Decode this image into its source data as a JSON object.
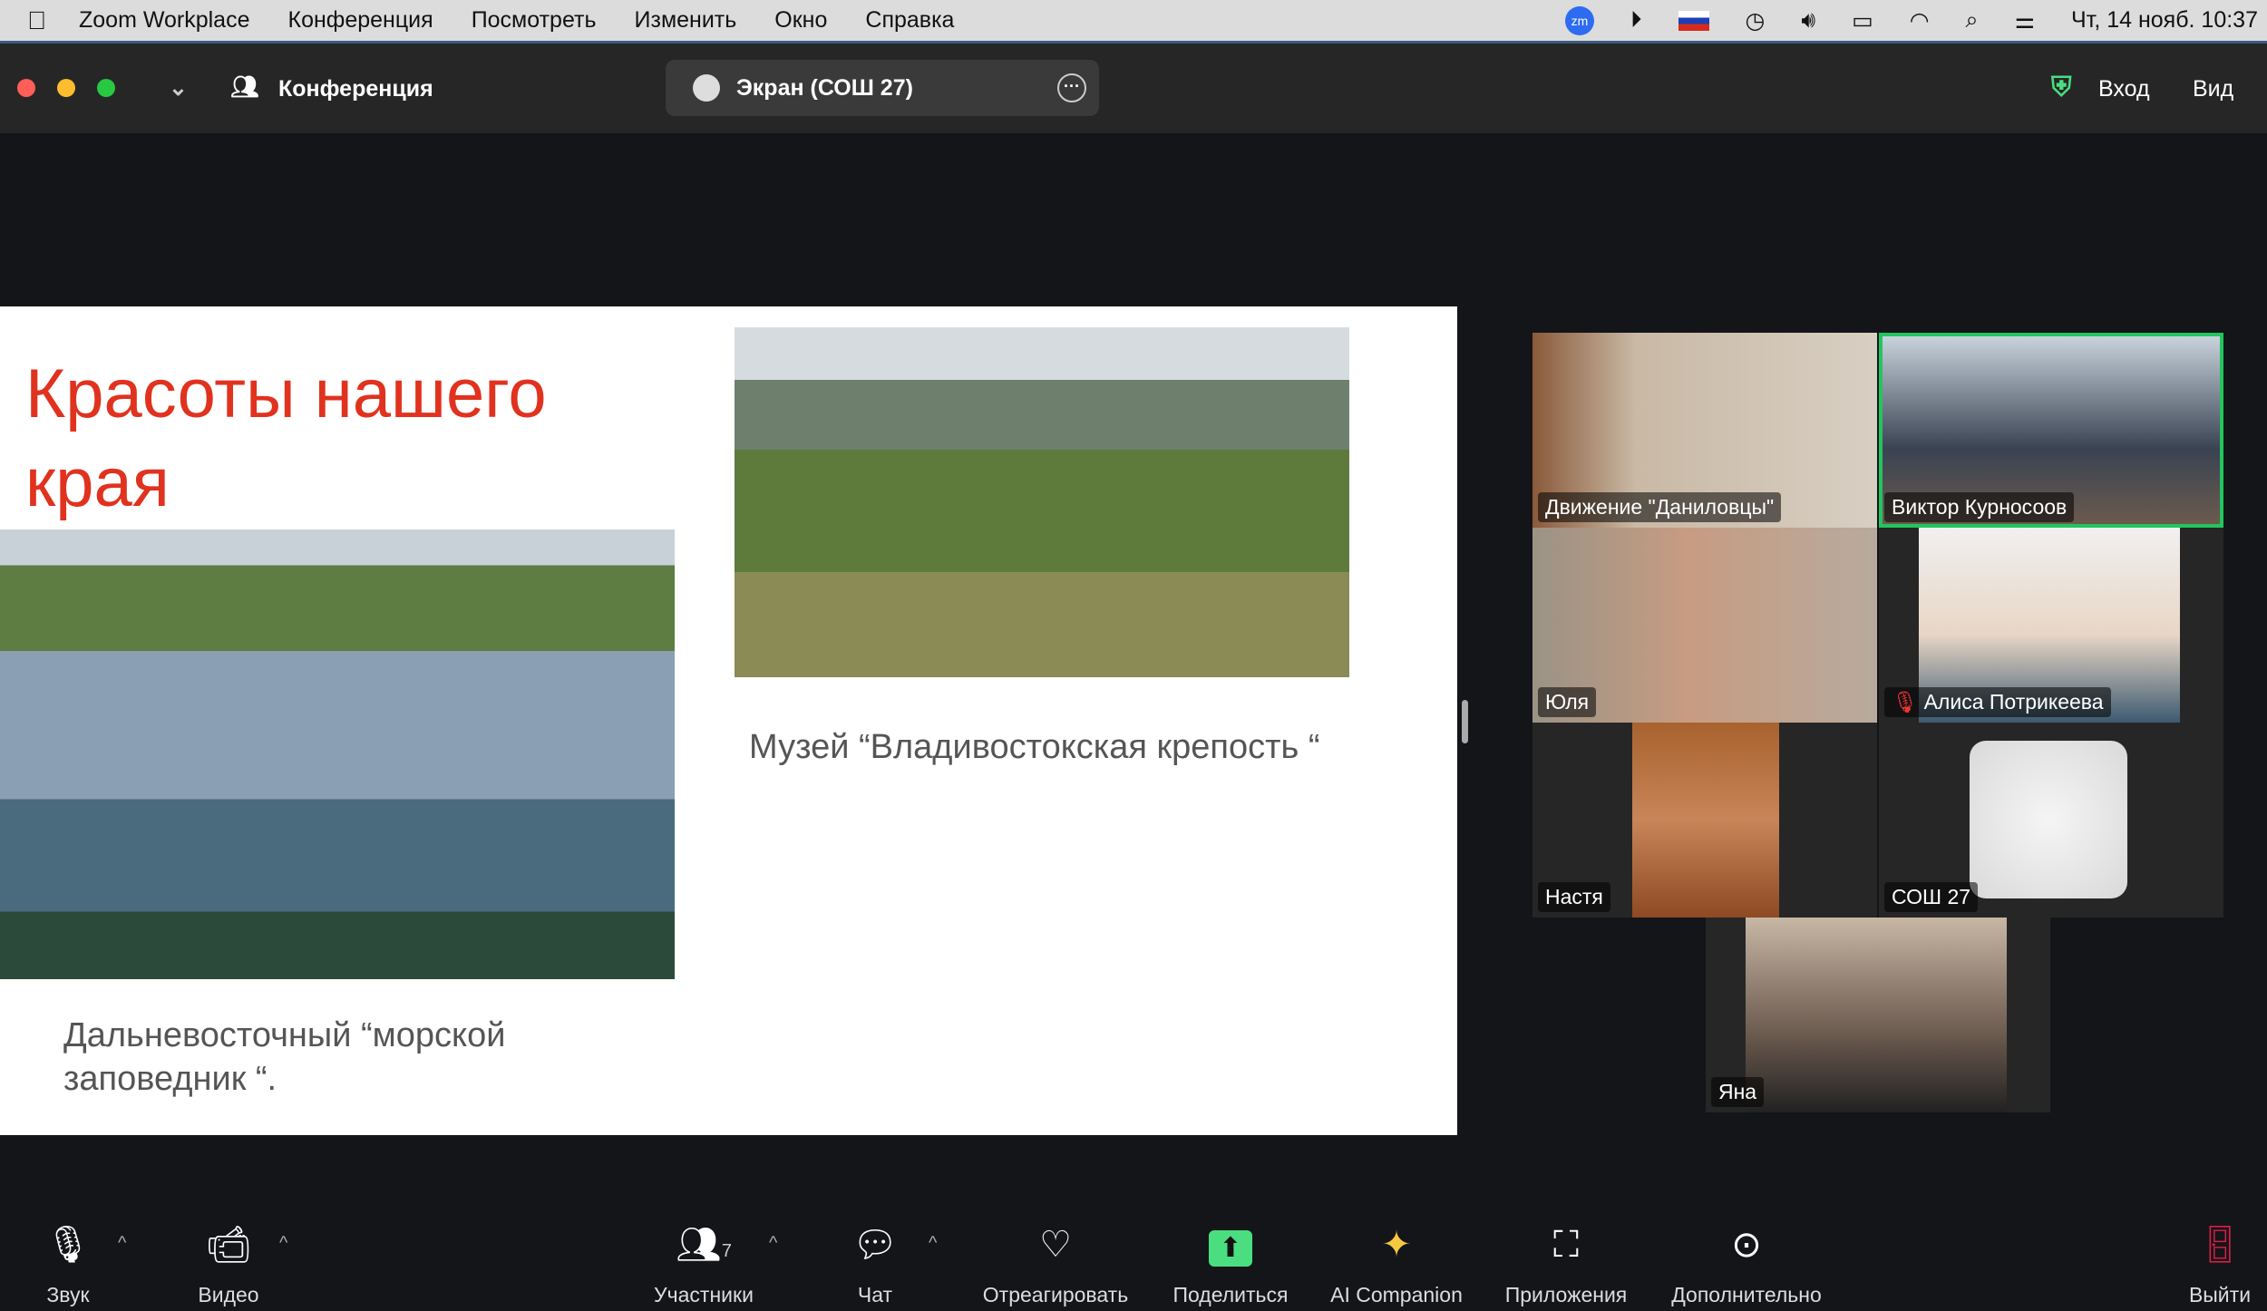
{
  "menubar": {
    "app": "Zoom Workplace",
    "items": [
      "Конференция",
      "Посмотреть",
      "Изменить",
      "Окно",
      "Справка"
    ],
    "clock": "Чт, 14 нояб. 10:37"
  },
  "titlebar": {
    "meeting_label": "Конференция",
    "screen_title": "Экран (СОШ 27)",
    "login": "Вход",
    "view": "Вид"
  },
  "slide": {
    "title": "Красоты нашего края",
    "caption_left": "Дальневосточный “морской заповедник “.",
    "caption_right": "Музей “Владивостокская крепость “"
  },
  "participants": [
    {
      "name": "Движение \"Даниловцы\""
    },
    {
      "name": "Виктор Курносоов",
      "active": true
    },
    {
      "name": "Юля"
    },
    {
      "name": "Алиса Потрикеева",
      "muted": true
    },
    {
      "name": "Настя"
    },
    {
      "name": "СОШ 27"
    },
    {
      "name": "Яна"
    }
  ],
  "toolbar": {
    "audio": "Звук",
    "video": "Видео",
    "participants": "Участники",
    "participants_count": "7",
    "chat": "Чат",
    "react": "Отреагировать",
    "share": "Поделиться",
    "ai": "AI Companion",
    "apps": "Приложения",
    "more": "Дополнительно",
    "leave": "Выйти"
  },
  "colors": {
    "accent_green": "#22c55e",
    "title_red": "#e0321e",
    "share_green": "#4ade80"
  }
}
